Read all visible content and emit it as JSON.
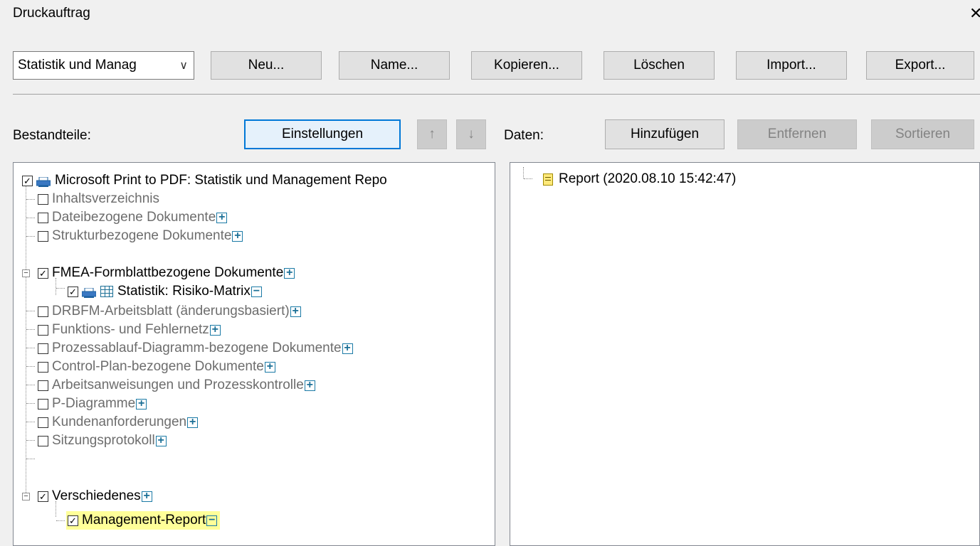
{
  "window": {
    "title": "Druckauftrag",
    "close_glyph": "✕"
  },
  "toolbar": {
    "combo_value": "Statistik und Manag",
    "new_label": "Neu...",
    "name_label": "Name...",
    "copy_label": "Kopieren...",
    "delete_label": "Löschen",
    "import_label": "Import...",
    "export_label": "Export..."
  },
  "components": {
    "label": "Bestandteile:",
    "settings_label": "Einstellungen",
    "up_glyph": "↑",
    "down_glyph": "↓"
  },
  "data": {
    "label": "Daten:",
    "add_label": "Hinzufügen",
    "remove_label": "Entfernen",
    "sort_label": "Sortieren"
  },
  "tree": {
    "root": "Microsoft Print to PDF: Statistik und Management Repo",
    "items": [
      "Inhaltsverzeichnis",
      "Dateibezogene Dokumente",
      "Strukturbezogene Dokumente",
      "FMEA-Formblattbezogene Dokumente",
      "Statistik: Risiko-Matrix",
      "DRBFM-Arbeitsblatt (änderungsbasiert)",
      "Funktions- und Fehlernetz",
      "Prozessablauf-Diagramm-bezogene Dokumente",
      "Control-Plan-bezogene Dokumente",
      "Arbeitsanweisungen und Prozesskontrolle",
      "P-Diagramme",
      "Kundenanforderungen",
      "Sitzungsprotokoll",
      "Verschiedenes",
      "Management-Report"
    ]
  },
  "data_tree": {
    "report": "Report (2020.08.10 15:42:47)"
  },
  "colors": {
    "accent": "#0078d7",
    "highlight": "#ffff99",
    "plus": "#1b6f96"
  }
}
